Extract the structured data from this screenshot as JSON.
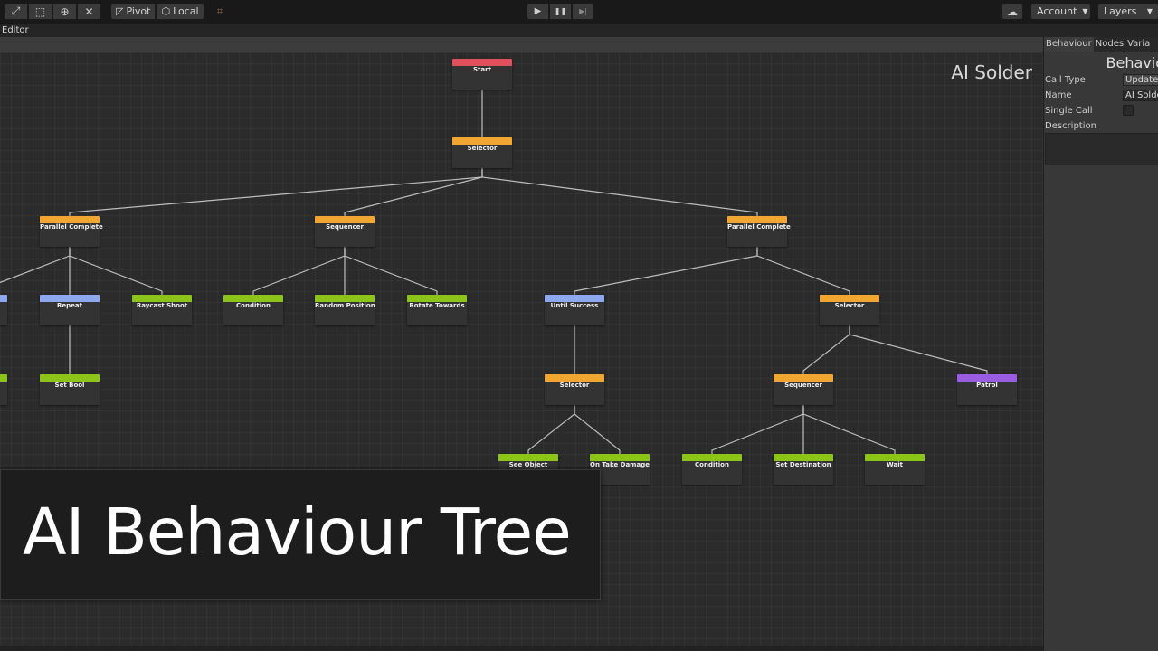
{
  "toolbar": {
    "tools": [
      {
        "icon": "expand-icon",
        "glyph": "⤢"
      },
      {
        "icon": "rect-tool-icon",
        "glyph": "⬚"
      },
      {
        "icon": "transform-icon",
        "glyph": "⊕"
      },
      {
        "icon": "custom-tool-icon",
        "glyph": "✕"
      }
    ],
    "pivot_label": "Pivot",
    "local_label": "Local",
    "grid_snap_icon": "⌗",
    "play_icon": "▶",
    "pause_icon": "❚❚",
    "step_icon": "▶|",
    "cloud_icon": "☁",
    "account_label": "Account",
    "layers_label": "Layers"
  },
  "editor": {
    "title": "Editor"
  },
  "graph": {
    "tree_name": "AI Solder",
    "header_colors": {
      "start": "#e0505a",
      "composite": "#f0a630",
      "decorator": "#8ea8f0",
      "action": "#8cc41a",
      "custom": "#9a5ce0"
    },
    "nodes": [
      {
        "id": "n0",
        "label": "Start",
        "kind": "start"
      },
      {
        "id": "n1",
        "label": "Selector",
        "kind": "composite"
      },
      {
        "id": "n2",
        "label": "Parallel Complete",
        "kind": "composite"
      },
      {
        "id": "n3",
        "label": "Sequencer",
        "kind": "composite"
      },
      {
        "id": "n4",
        "label": "Parallel Complete",
        "kind": "composite"
      },
      {
        "id": "n5",
        "label": "",
        "kind": "decorator"
      },
      {
        "id": "n6",
        "label": "Repeat",
        "kind": "decorator"
      },
      {
        "id": "n7",
        "label": "Raycast Shoot",
        "kind": "action"
      },
      {
        "id": "n8",
        "label": "Condition",
        "kind": "action"
      },
      {
        "id": "n9",
        "label": "Random Position",
        "kind": "action"
      },
      {
        "id": "n10",
        "label": "Rotate Towards",
        "kind": "action"
      },
      {
        "id": "n11",
        "label": "Until Success",
        "kind": "decorator"
      },
      {
        "id": "n12",
        "label": "Selector",
        "kind": "composite"
      },
      {
        "id": "n13",
        "label": "",
        "kind": "action"
      },
      {
        "id": "n14",
        "label": "Set Bool",
        "kind": "action"
      },
      {
        "id": "n15",
        "label": "Selector",
        "kind": "composite"
      },
      {
        "id": "n16",
        "label": "Sequencer",
        "kind": "composite"
      },
      {
        "id": "n17",
        "label": "Patrol",
        "kind": "custom"
      },
      {
        "id": "n18",
        "label": "See Object",
        "kind": "action"
      },
      {
        "id": "n19",
        "label": "On Take Damage",
        "kind": "action"
      },
      {
        "id": "n20",
        "label": "Condition",
        "kind": "action"
      },
      {
        "id": "n21",
        "label": "Set Destination",
        "kind": "action"
      },
      {
        "id": "n22",
        "label": "Wait",
        "kind": "action"
      }
    ],
    "edges": [
      [
        "n0",
        "n1"
      ],
      [
        "n1",
        "n2"
      ],
      [
        "n1",
        "n3"
      ],
      [
        "n1",
        "n4"
      ],
      [
        "n2",
        "n5"
      ],
      [
        "n2",
        "n6"
      ],
      [
        "n2",
        "n7"
      ],
      [
        "n3",
        "n8"
      ],
      [
        "n3",
        "n9"
      ],
      [
        "n3",
        "n10"
      ],
      [
        "n4",
        "n11"
      ],
      [
        "n4",
        "n12"
      ],
      [
        "n5",
        "n13"
      ],
      [
        "n6",
        "n14"
      ],
      [
        "n11",
        "n15"
      ],
      [
        "n12",
        "n16"
      ],
      [
        "n12",
        "n17"
      ],
      [
        "n15",
        "n18"
      ],
      [
        "n15",
        "n19"
      ],
      [
        "n16",
        "n20"
      ],
      [
        "n16",
        "n21"
      ],
      [
        "n16",
        "n22"
      ]
    ]
  },
  "inspector": {
    "tabs": [
      "Behaviour",
      "Nodes",
      "Varia"
    ],
    "heading": "Behavio",
    "call_type_label": "Call Type",
    "call_type_value": "Update",
    "name_label": "Name",
    "name_value": "AI Solde",
    "single_call_label": "Single Call",
    "single_call_checked": false,
    "description_label": "Description"
  },
  "banner": {
    "text": "AI Behaviour Tree"
  }
}
